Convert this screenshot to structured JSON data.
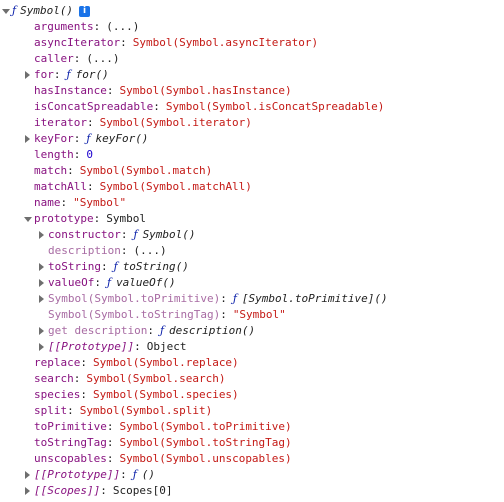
{
  "root": {
    "fn_keyword": "ƒ",
    "title": "Symbol()",
    "info_icon_glyph": "i"
  },
  "props": [
    {
      "key": "arguments",
      "value": "(...)",
      "kind": "plain",
      "depth": 1,
      "toggle": "none",
      "dim": false
    },
    {
      "key": "asyncIterator",
      "value": "Symbol(Symbol.asyncIterator)",
      "kind": "sym",
      "depth": 1,
      "toggle": "none",
      "dim": false
    },
    {
      "key": "caller",
      "value": "(...)",
      "kind": "plain",
      "depth": 1,
      "toggle": "none",
      "dim": false
    },
    {
      "key": "for",
      "fn": "for()",
      "kind": "fn",
      "depth": 1,
      "toggle": "collapsed",
      "dim": false
    },
    {
      "key": "hasInstance",
      "value": "Symbol(Symbol.hasInstance)",
      "kind": "sym",
      "depth": 1,
      "toggle": "none",
      "dim": false
    },
    {
      "key": "isConcatSpreadable",
      "value": "Symbol(Symbol.isConcatSpreadable)",
      "kind": "sym",
      "depth": 1,
      "toggle": "none",
      "dim": false
    },
    {
      "key": "iterator",
      "value": "Symbol(Symbol.iterator)",
      "kind": "sym",
      "depth": 1,
      "toggle": "none",
      "dim": false
    },
    {
      "key": "keyFor",
      "fn": "keyFor()",
      "kind": "fn",
      "depth": 1,
      "toggle": "collapsed",
      "dim": false
    },
    {
      "key": "length",
      "value": "0",
      "kind": "num",
      "depth": 1,
      "toggle": "none",
      "dim": false
    },
    {
      "key": "match",
      "value": "Symbol(Symbol.match)",
      "kind": "sym",
      "depth": 1,
      "toggle": "none",
      "dim": false
    },
    {
      "key": "matchAll",
      "value": "Symbol(Symbol.matchAll)",
      "kind": "sym",
      "depth": 1,
      "toggle": "none",
      "dim": false
    },
    {
      "key": "name",
      "value": "\"Symbol\"",
      "kind": "str",
      "depth": 1,
      "toggle": "none",
      "dim": false
    },
    {
      "key": "prototype",
      "value": "Symbol",
      "kind": "plain",
      "depth": 1,
      "toggle": "expanded",
      "dim": false
    },
    {
      "key": "constructor",
      "fn": "Symbol()",
      "kind": "fn",
      "depth": 2,
      "toggle": "collapsed",
      "dim": false
    },
    {
      "key": "description",
      "value": "(...)",
      "kind": "plain",
      "depth": 2,
      "toggle": "none",
      "dim": true
    },
    {
      "key": "toString",
      "fn": "toString()",
      "kind": "fn",
      "depth": 2,
      "toggle": "collapsed",
      "dim": false
    },
    {
      "key": "valueOf",
      "fn": "valueOf()",
      "kind": "fn",
      "depth": 2,
      "toggle": "collapsed",
      "dim": false
    },
    {
      "key": "Symbol(Symbol.toPrimitive)",
      "fn": "[Symbol.toPrimitive]()",
      "kind": "fn",
      "depth": 2,
      "toggle": "collapsed",
      "dim": true
    },
    {
      "key": "Symbol(Symbol.toStringTag)",
      "value": "\"Symbol\"",
      "kind": "str",
      "depth": 2,
      "toggle": "none",
      "dim": true
    },
    {
      "key": "get description",
      "fn": "description()",
      "kind": "fn",
      "depth": 2,
      "toggle": "collapsed",
      "dim": true
    },
    {
      "key": "[[Prototype]]",
      "value": "Object",
      "kind": "plain",
      "depth": 2,
      "toggle": "collapsed",
      "dim": false,
      "internal": true
    },
    {
      "key": "replace",
      "value": "Symbol(Symbol.replace)",
      "kind": "sym",
      "depth": 1,
      "toggle": "none",
      "dim": false
    },
    {
      "key": "search",
      "value": "Symbol(Symbol.search)",
      "kind": "sym",
      "depth": 1,
      "toggle": "none",
      "dim": false
    },
    {
      "key": "species",
      "value": "Symbol(Symbol.species)",
      "kind": "sym",
      "depth": 1,
      "toggle": "none",
      "dim": false
    },
    {
      "key": "split",
      "value": "Symbol(Symbol.split)",
      "kind": "sym",
      "depth": 1,
      "toggle": "none",
      "dim": false
    },
    {
      "key": "toPrimitive",
      "value": "Symbol(Symbol.toPrimitive)",
      "kind": "sym",
      "depth": 1,
      "toggle": "none",
      "dim": false
    },
    {
      "key": "toStringTag",
      "value": "Symbol(Symbol.toStringTag)",
      "kind": "sym",
      "depth": 1,
      "toggle": "none",
      "dim": false
    },
    {
      "key": "unscopables",
      "value": "Symbol(Symbol.unscopables)",
      "kind": "sym",
      "depth": 1,
      "toggle": "none",
      "dim": false
    },
    {
      "key": "[[Prototype]]",
      "fn": "()",
      "kind": "fn",
      "depth": 1,
      "toggle": "collapsed",
      "dim": false,
      "internal": true
    },
    {
      "key": "[[Scopes]]",
      "value": "Scopes[0]",
      "kind": "plain",
      "depth": 1,
      "toggle": "collapsed",
      "dim": false,
      "internal": true
    }
  ],
  "colors": {
    "key": "#881280",
    "key_dim": "#a86ba3",
    "string": "#c41a16",
    "number": "#1c00cf",
    "function_keyword": "#0d22aa",
    "info_icon": "#1a73e8"
  }
}
